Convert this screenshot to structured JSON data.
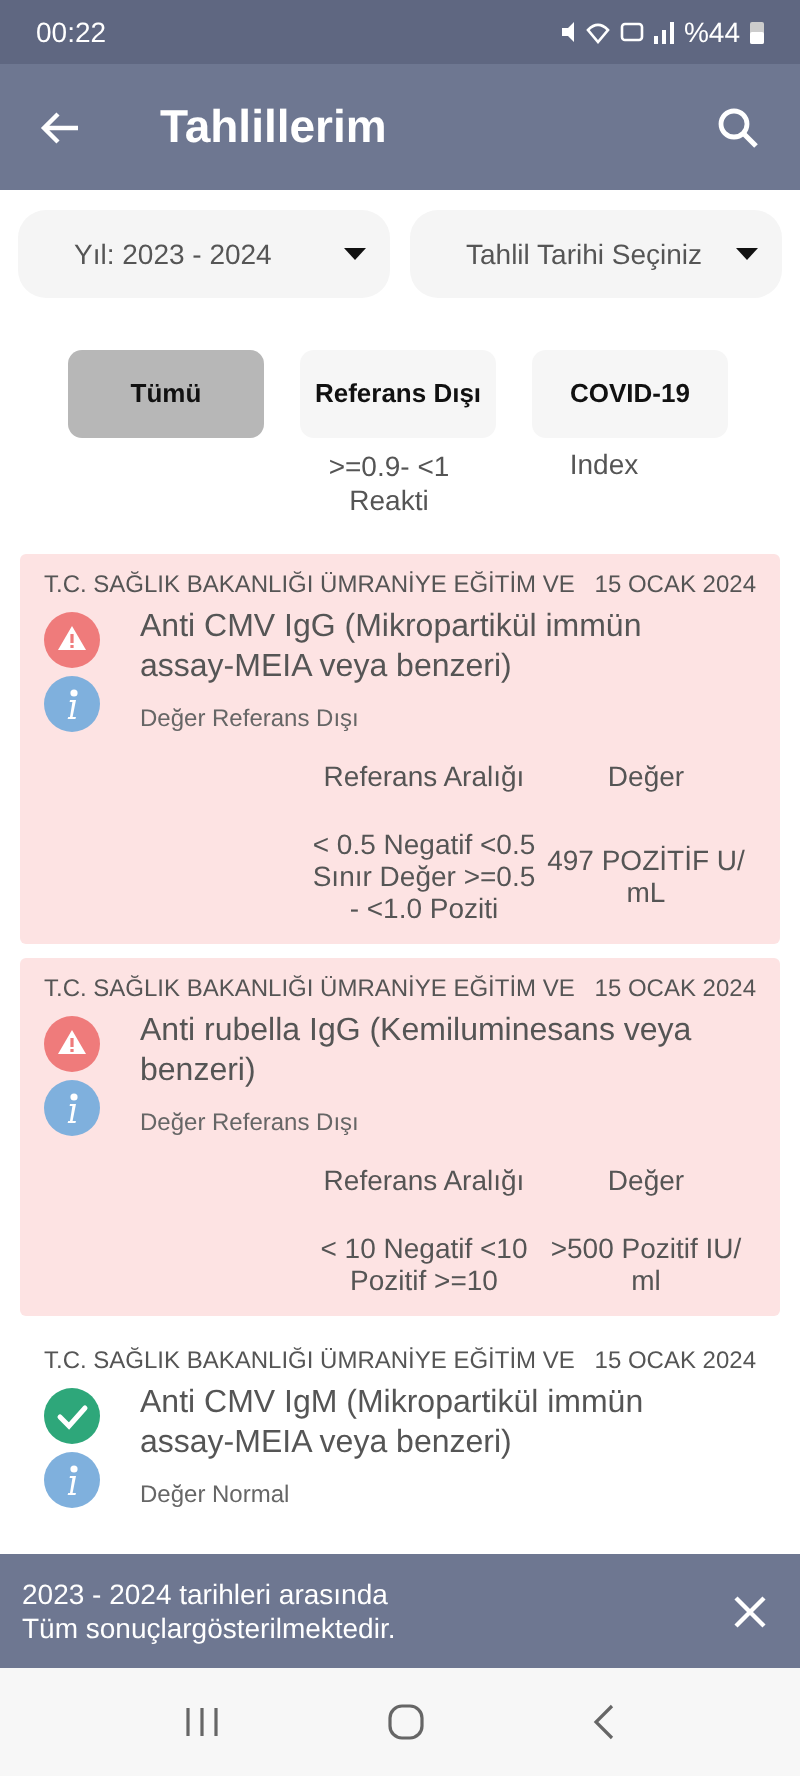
{
  "status_bar": {
    "time": "00:22",
    "battery": "%44"
  },
  "app_bar": {
    "title": "Tahlillerim"
  },
  "filters": [
    {
      "label": "Yıl: 2023 - 2024"
    },
    {
      "label": "Tahlil Tarihi Seçiniz"
    }
  ],
  "tabs": [
    {
      "label": "Tümü",
      "selected": true
    },
    {
      "label": "Referans Dışı",
      "selected": false
    },
    {
      "label": "COVID-19",
      "selected": false
    }
  ],
  "peek": {
    "range_lines": [
      ">=0.9- <1",
      "Reakti"
    ],
    "value": "Index"
  },
  "results": [
    {
      "institution": "T.C. SAĞLIK BAKANLIĞI ÜMRANİYE EĞİTİM VE",
      "date": "15 OCAK 2024",
      "kind": "abnormal",
      "name": "Anti CMV IgG (Mikropartikül immün assay-MEIA veya benzeri)",
      "status_text": "Değer Referans Dışı",
      "range_header": "Referans Aralığı",
      "value_header": "Değer",
      "range": "< 0.5 Negatif <0.5 Sınır Değer >=0.5 - <1.0 Poziti",
      "value": "497 POZİTİF U/ mL"
    },
    {
      "institution": "T.C. SAĞLIK BAKANLIĞI ÜMRANİYE EĞİTİM VE",
      "date": "15 OCAK 2024",
      "kind": "abnormal",
      "name": "Anti rubella IgG (Kemiluminesans veya benzeri)",
      "status_text": "Değer Referans Dışı",
      "range_header": "Referans Aralığı",
      "value_header": "Değer",
      "range": "< 10 Negatif <10 Pozitif >=10",
      "value": ">500 Pozitif IU/ ml"
    },
    {
      "institution": "T.C. SAĞLIK BAKANLIĞI ÜMRANİYE EĞİTİM VE",
      "date": "15 OCAK 2024",
      "kind": "normal",
      "name": "Anti CMV IgM (Mikropartikül immün assay-MEIA veya benzeri)",
      "status_text": "Değer Normal"
    }
  ],
  "snackbar": {
    "message": "2023 - 2024 tarihleri arasında Tüm sonuçlargösterilmektedir."
  }
}
